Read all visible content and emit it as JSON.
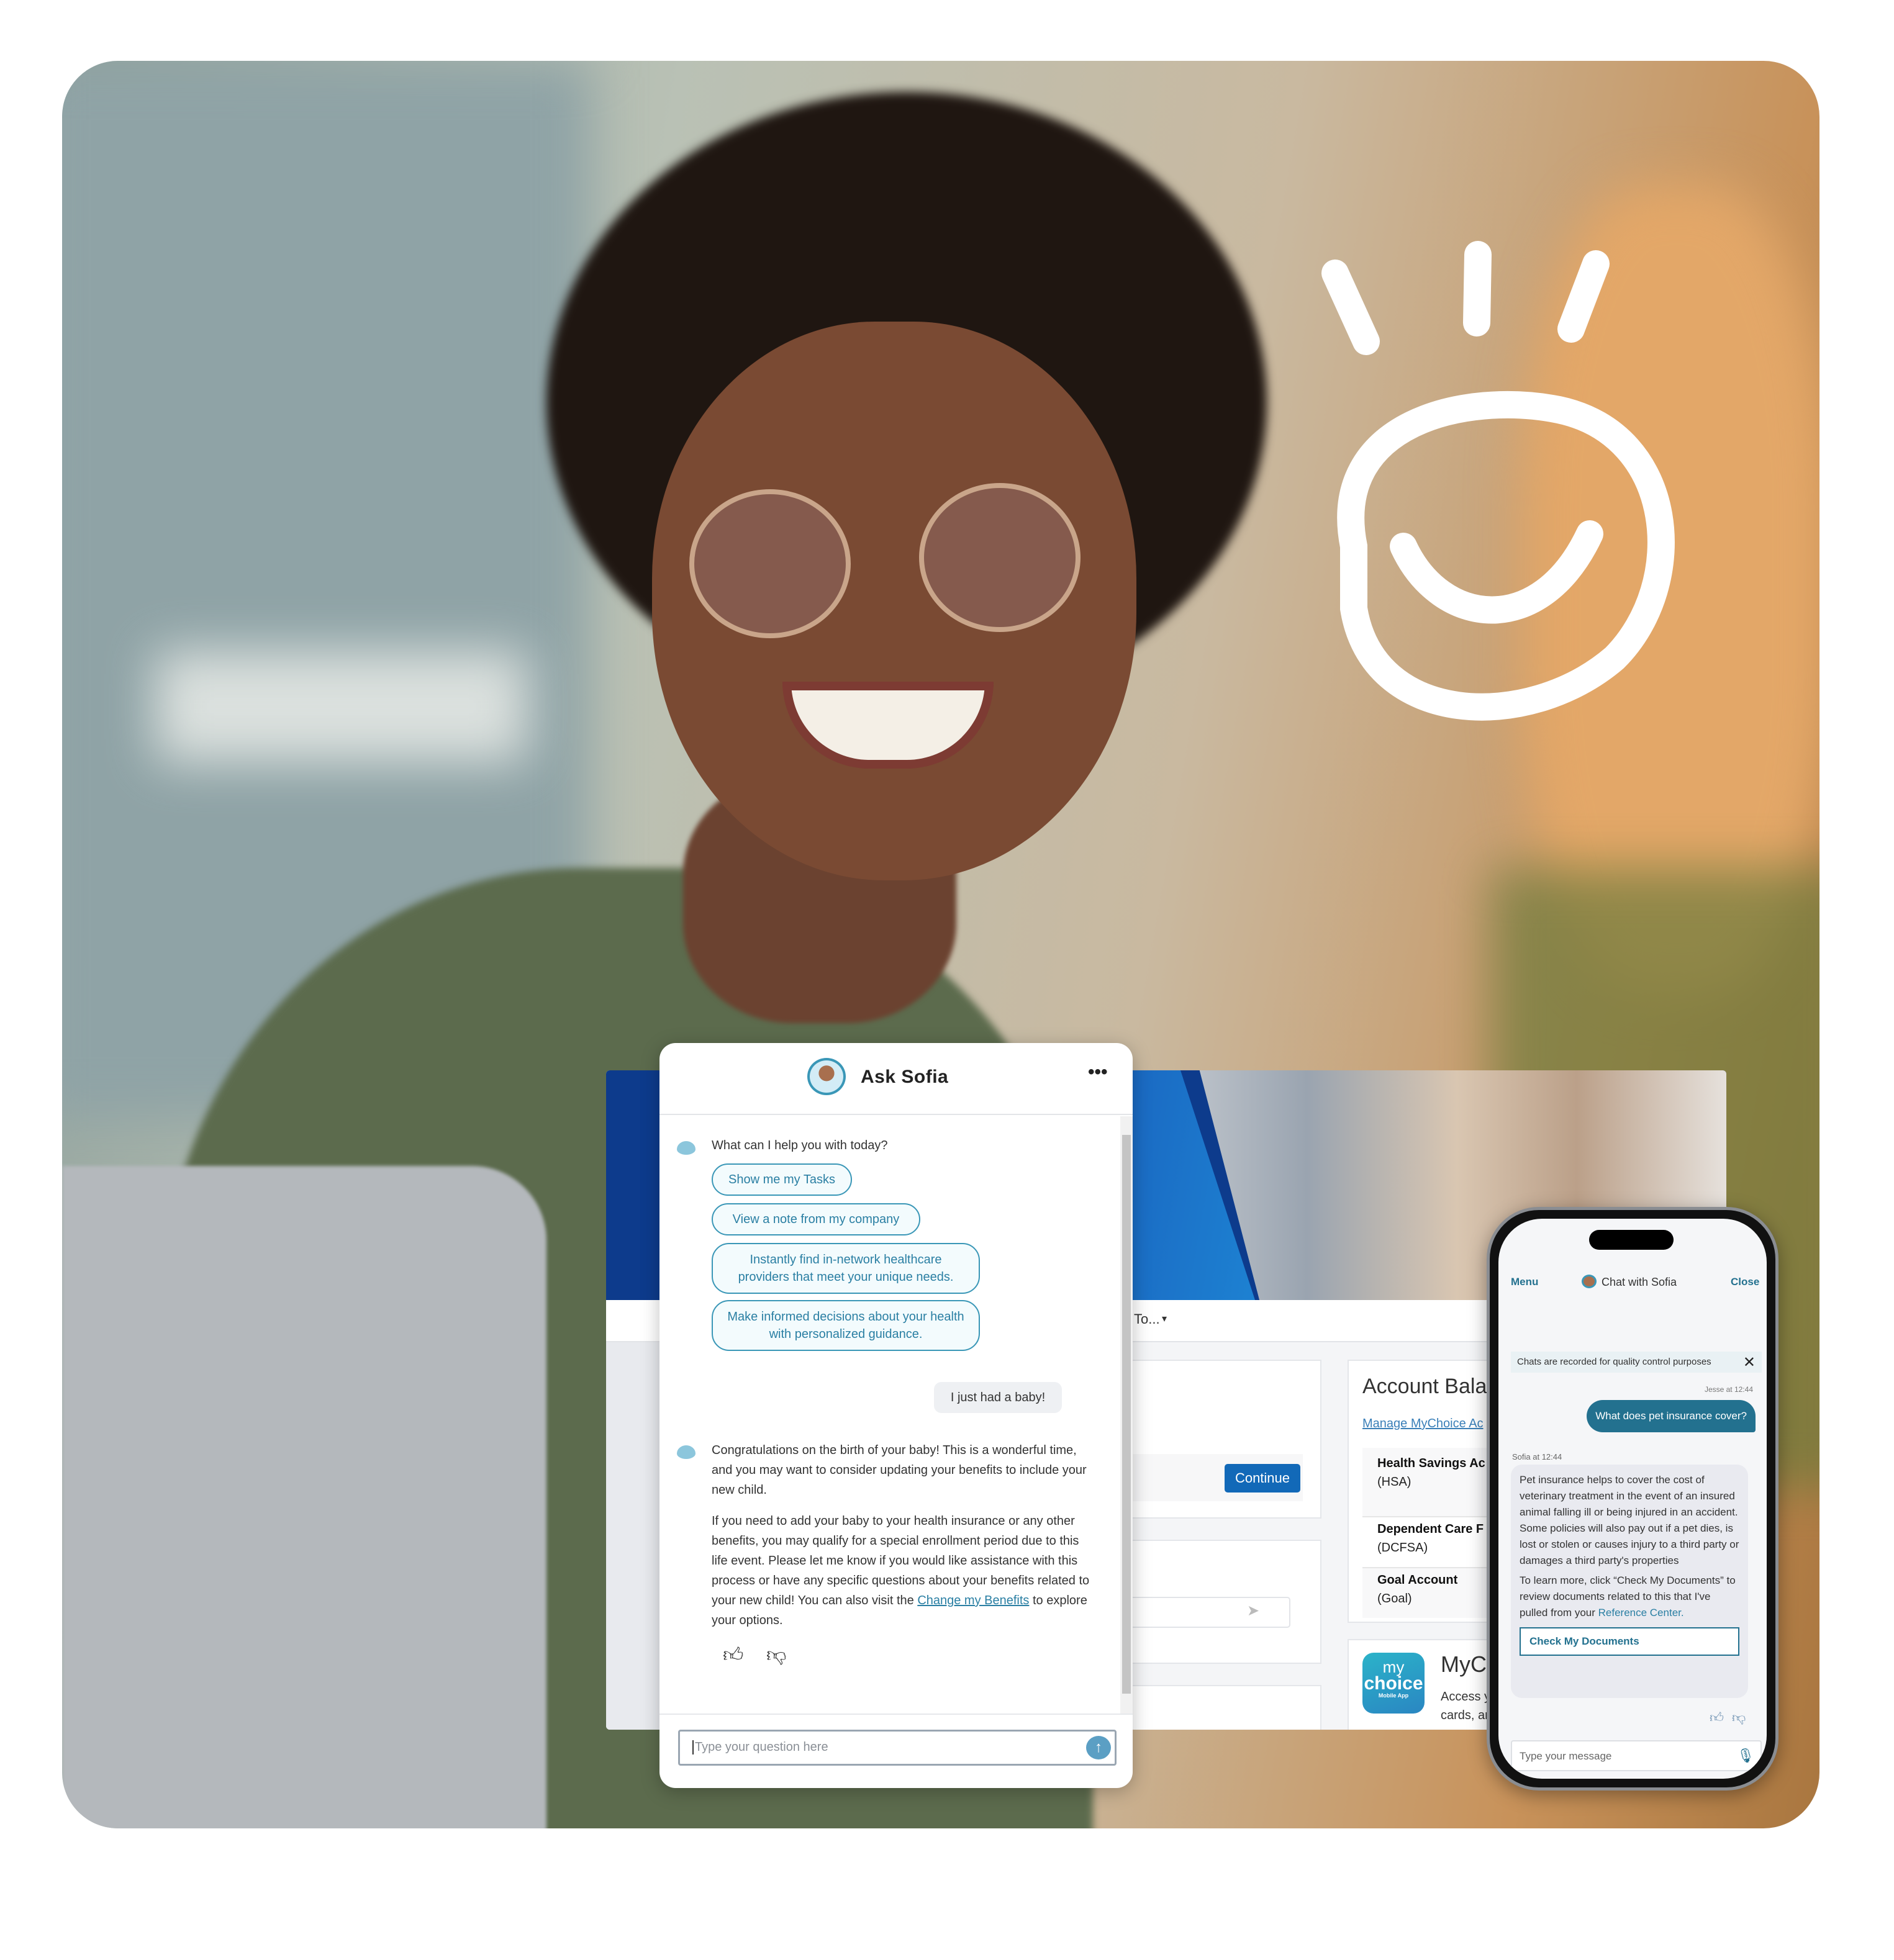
{
  "chat_widget": {
    "title": "Ask Sofia",
    "menu_icon": "more-horizontal-icon",
    "greeting": "What can I help you with today?",
    "suggestions": [
      "Show me my Tasks",
      "View a note from my company",
      "Instantly find in-network healthcare providers that meet your unique needs.",
      "Make informed decisions about your health with personalized guidance."
    ],
    "user_message": "I just had a baby!",
    "bot_reply_p1": "Congratulations on the birth of your baby! This is a wonderful time, and you may want to consider updating your benefits to include your new child.",
    "bot_reply_p2_before": "If you need to add your baby to your health insurance or any other benefits, you may qualify for a special enrollment period due to this life event. Please let me know if you would like assistance with this process or have any specific questions about your benefits related to your new child! You can also visit the ",
    "bot_reply_link": "Change my Benefits",
    "bot_reply_p2_after": " to explore your options.",
    "input_placeholder": "Type your question here",
    "accent_color": "#3a97b7"
  },
  "portal": {
    "nav_dropdown": "To...",
    "continue_button": "Continue",
    "account_title": "Account Balan",
    "manage_link": "Manage MyChoice Ac",
    "accounts": [
      {
        "name": "Health Savings Ac",
        "code": "(HSA)"
      },
      {
        "name": "Dependent Care F",
        "code": "(DCFSA)"
      },
      {
        "name": "Goal Account",
        "code": "(Goal)"
      }
    ],
    "app_logo": {
      "line1": "my",
      "line2": "choice",
      "line3": "Mobile App"
    },
    "app_title": "MyCh",
    "app_desc_1": "Access y",
    "app_desc_2": "cards, ar",
    "primary_color": "#0d3b8c",
    "button_color": "#1269b8"
  },
  "phone_chat": {
    "menu": "Menu",
    "title": "Chat with Sofia",
    "close": "Close",
    "notice": "Chats are recorded for quality control purposes",
    "user_meta": "Jesse at 12:44",
    "user_message": "What does pet insurance cover?",
    "bot_meta": "Sofia at 12:44",
    "bot_p1": "Pet insurance helps to cover the cost of veterinary treatment in the event of an insured animal falling ill or being injured in an accident. Some policies will also pay out if a pet dies, is lost or stolen or causes injury to a third party or damages a third party's properties",
    "bot_p2_before": "To learn more, click “Check My Documents” to review documents related to this that I've pulled from your ",
    "bot_p2_link": "Reference Center.",
    "action_button": "Check My Documents",
    "input_placeholder": "Type your message",
    "bubble_color": "#23718f"
  }
}
